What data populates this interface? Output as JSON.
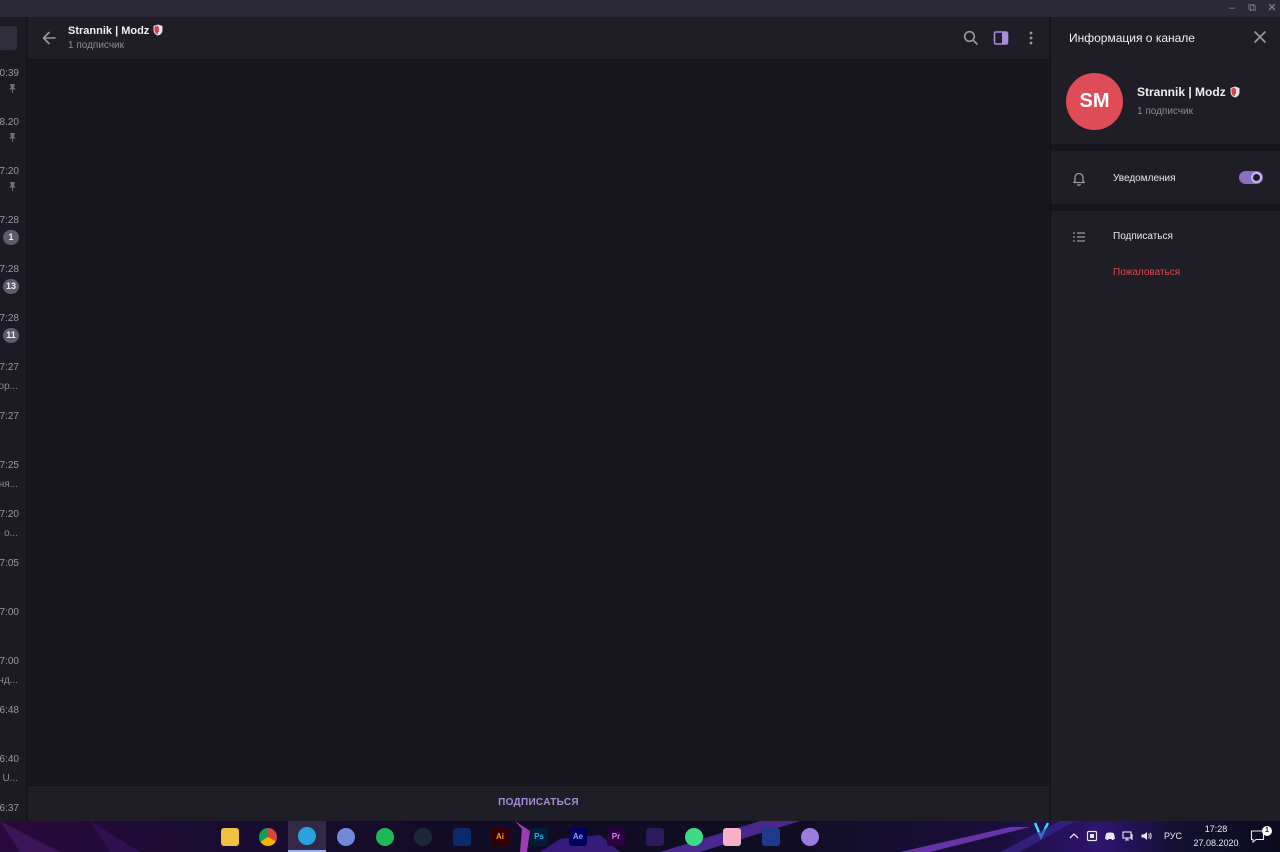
{
  "window": {
    "minimize": "–",
    "maximize": "⧉",
    "close": "✕"
  },
  "chatlist": {
    "items": [
      {
        "time": "0:39",
        "indicator": "pin"
      },
      {
        "time": "8.20",
        "indicator": "pin"
      },
      {
        "time": "7:20",
        "indicator": "pin"
      },
      {
        "time": "7:28",
        "badge": "1"
      },
      {
        "time": "7:28",
        "badge": "13"
      },
      {
        "time": "7:28",
        "badge": "11"
      },
      {
        "time": "7:27",
        "preview": "ор..."
      },
      {
        "time": "7:27",
        "preview": ""
      },
      {
        "time": "7:25",
        "preview": "ня..."
      },
      {
        "time": "7:20",
        "preview": "о..."
      },
      {
        "time": "7:05",
        "preview": ""
      },
      {
        "time": "7:00",
        "preview": ""
      },
      {
        "time": "7:00",
        "preview": "нд..."
      },
      {
        "time": "6:48",
        "preview": ""
      },
      {
        "time": "6:40",
        "preview": "U..."
      },
      {
        "time": "6:37",
        "preview": ""
      }
    ]
  },
  "header": {
    "title": "Strannik | Modz",
    "subtitle": "1 подписчик",
    "icons": [
      "search-icon",
      "sidebar-toggle-icon",
      "more-vertical-icon"
    ]
  },
  "footer": {
    "subscribe_label": "ПОДПИСАТЬСЯ"
  },
  "info_panel": {
    "title": "Информация о канале",
    "avatar_initials": "SM",
    "avatar_color": "#de4c58",
    "channel_name": "Strannik | Modz",
    "subscribers": "1 подписчик",
    "notifications_label": "Уведомления",
    "notifications_on": true,
    "subscribe_label": "Подписаться",
    "report_label": "Пожаловаться"
  },
  "taskbar": {
    "apps": [
      "file-explorer",
      "chrome",
      "telegram",
      "discord",
      "spotify",
      "steam",
      "app-blue",
      "illustrator",
      "photoshop",
      "after-effects",
      "premiere",
      "app-purple",
      "maps-pin",
      "anime-char",
      "visual-studio",
      "app-cat"
    ],
    "active_app": "telegram",
    "app_labels": {
      "illustrator": "Ai",
      "photoshop": "Ps",
      "after-effects": "Ae",
      "premiere": "Pr"
    },
    "language": "РУС",
    "time": "17:28",
    "date": "27.08.2020"
  },
  "colors": {
    "accent": "#a68ed8",
    "danger": "#e0474f",
    "background": "#18161e",
    "panel": "#1f1d26"
  }
}
